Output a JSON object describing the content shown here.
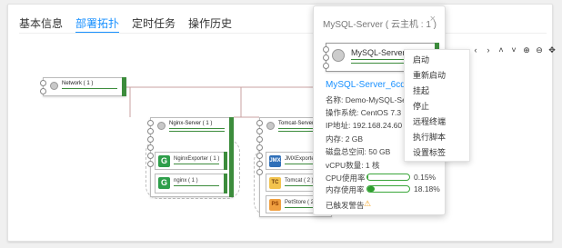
{
  "tabs": [
    {
      "label": "基本信息",
      "active": false
    },
    {
      "label": "部署拓扑",
      "active": true
    },
    {
      "label": "定时任务",
      "active": false
    },
    {
      "label": "操作历史",
      "active": false
    }
  ],
  "toolbar": [
    {
      "icon": "chevron-left-icon",
      "glyph": "‹"
    },
    {
      "icon": "chevron-right-icon",
      "glyph": "›"
    },
    {
      "icon": "chevron-up-icon",
      "glyph": "˄"
    },
    {
      "icon": "chevron-down-icon",
      "glyph": "˅"
    },
    {
      "icon": "zoom-in-icon",
      "glyph": "⊕"
    },
    {
      "icon": "zoom-out-icon",
      "glyph": "⊖"
    },
    {
      "icon": "fit-icon",
      "glyph": "✥"
    }
  ],
  "topology": {
    "network": {
      "label": "Network ( 1 )"
    },
    "nginx_server": {
      "label": "Nginx-Server ( 1 )"
    },
    "nginx_exporter": {
      "label": "NginxExporter ( 1 )"
    },
    "nginx": {
      "label": "nginx ( 1 )"
    },
    "tomcat_server": {
      "label": "Tomcat-Server ( 2 )"
    },
    "jmx_exporter": {
      "label": "JMXExporter ( 2 )"
    },
    "tomcat": {
      "label": "Tomcat ( 2 )"
    },
    "petstore": {
      "label": "PetStore ( 2 )"
    }
  },
  "popup": {
    "title": "MySQL-Server ( 云主机 : 1 )",
    "close": "×",
    "node_label": "MySQL-Server_6...",
    "host_link": "MySQL-Server_6cqp3c",
    "info": [
      "名称:  Demo-MySQL-Se",
      "操作系统:  CentOS 7.3",
      "IP地址:  192.168.24.60",
      "内存:  2 GB",
      "磁盘总空间:  50 GB",
      "vCPU数量:  1 核"
    ],
    "metrics": [
      {
        "label": "CPU使用率",
        "value": "0.15%",
        "fraction": 0.0015
      },
      {
        "label": "内存使用率",
        "value": "18.18%",
        "fraction": 0.1818
      }
    ],
    "alarm_label": "已触发警告",
    "alarm_icon": "warning-icon"
  },
  "menu": [
    "启动",
    "重新启动",
    "挂起",
    "停止",
    "远程终端",
    "执行脚本",
    "设置标签"
  ],
  "colors": {
    "accent": "#1890ff",
    "status_green": "#3c8c3c",
    "link_line": "#c8a0a0",
    "warning": "#f5a623"
  }
}
